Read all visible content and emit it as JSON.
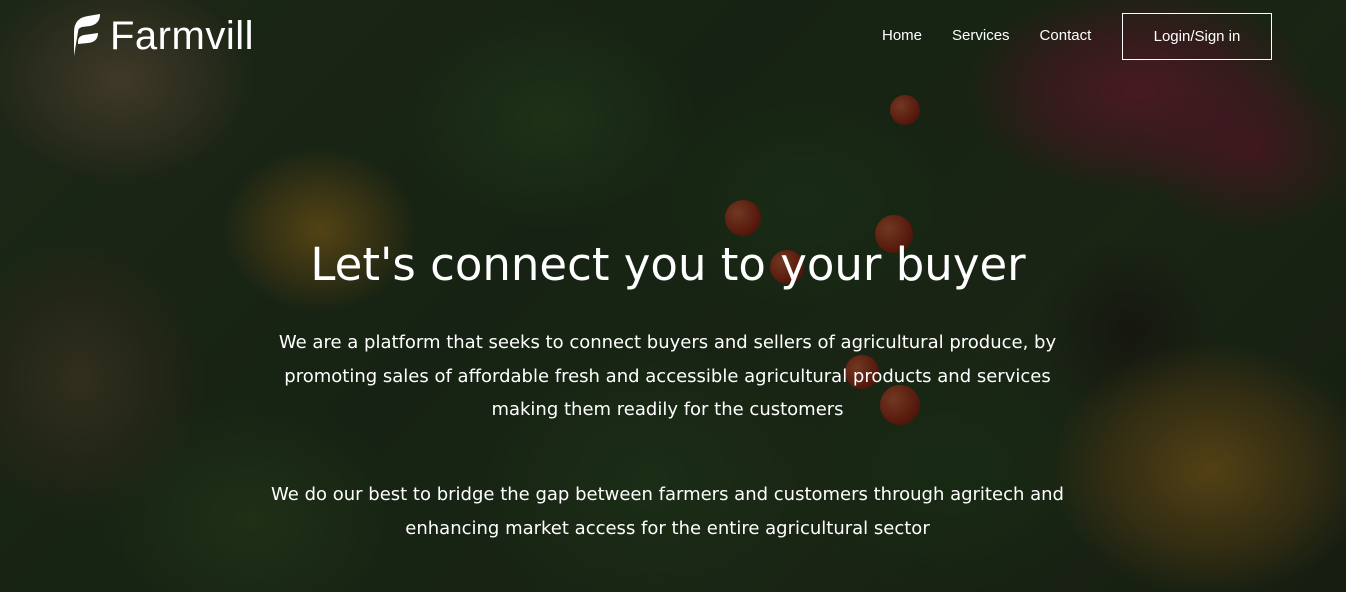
{
  "brand": {
    "name": "Farmvill",
    "logo_icon": "leaf-f-icon",
    "text_color": "#ffffff"
  },
  "nav": {
    "items": [
      {
        "label": "Home"
      },
      {
        "label": "Services"
      },
      {
        "label": "Contact"
      }
    ],
    "login_label": "Login/Sign in"
  },
  "hero": {
    "title": "Let's connect you to your buyer",
    "paragraph1": "We are a platform that seeks to connect buyers and sellers of agricultural produce, by promoting sales of affordable fresh and accessible agricultural products and services making them readily for the customers",
    "paragraph2": "We do our best to bridge the gap between farmers and customers through agritech and enhancing market access for the entire agricultural sector",
    "background_image": "assorted fresh vegetables, tomatoes and flowers",
    "overlay_color": "#080a06"
  }
}
